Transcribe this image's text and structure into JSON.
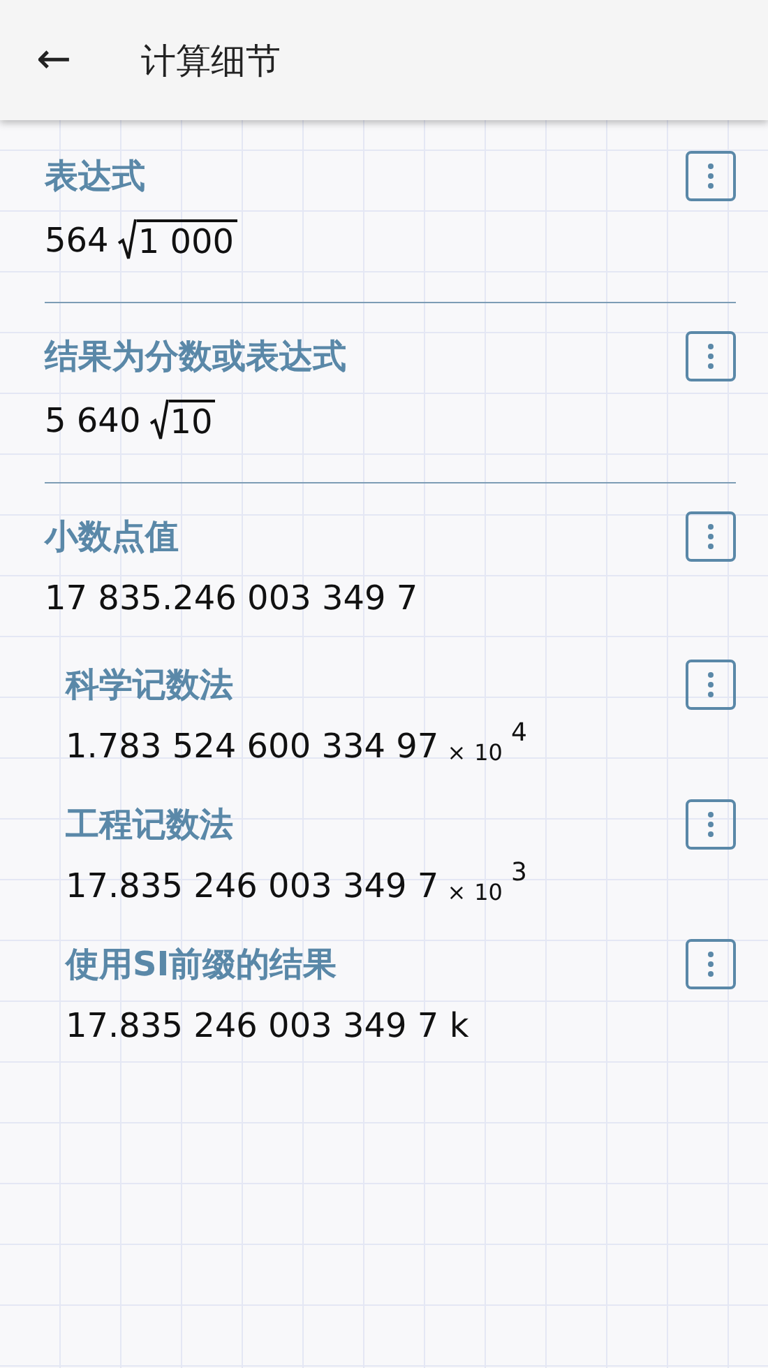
{
  "app_bar": {
    "back_icon": "←",
    "title": "计算细节"
  },
  "sections": [
    {
      "title": "表达式",
      "value": {
        "kind": "sqrt",
        "coefficient": "564",
        "radicand": "1 000"
      }
    },
    {
      "title": "结果为分数或表达式",
      "value": {
        "kind": "sqrt",
        "coefficient": "5 640",
        "radicand": "10"
      }
    },
    {
      "title": "小数点值",
      "value": {
        "kind": "plain",
        "text": "17 835.246 003 349 7"
      },
      "children": [
        {
          "title": "科学记数法",
          "value": {
            "kind": "power",
            "mantissa": "1.783 524 600 334 97",
            "times": "×",
            "base": "10",
            "exponent": "4"
          }
        },
        {
          "title": "工程记数法",
          "value": {
            "kind": "power",
            "mantissa": "17.835 246 003 349 7",
            "times": "×",
            "base": "10",
            "exponent": "3"
          }
        },
        {
          "title": "使用SI前缀的结果",
          "value": {
            "kind": "plain",
            "text": "17.835 246 003 349 7 k"
          }
        }
      ]
    }
  ]
}
